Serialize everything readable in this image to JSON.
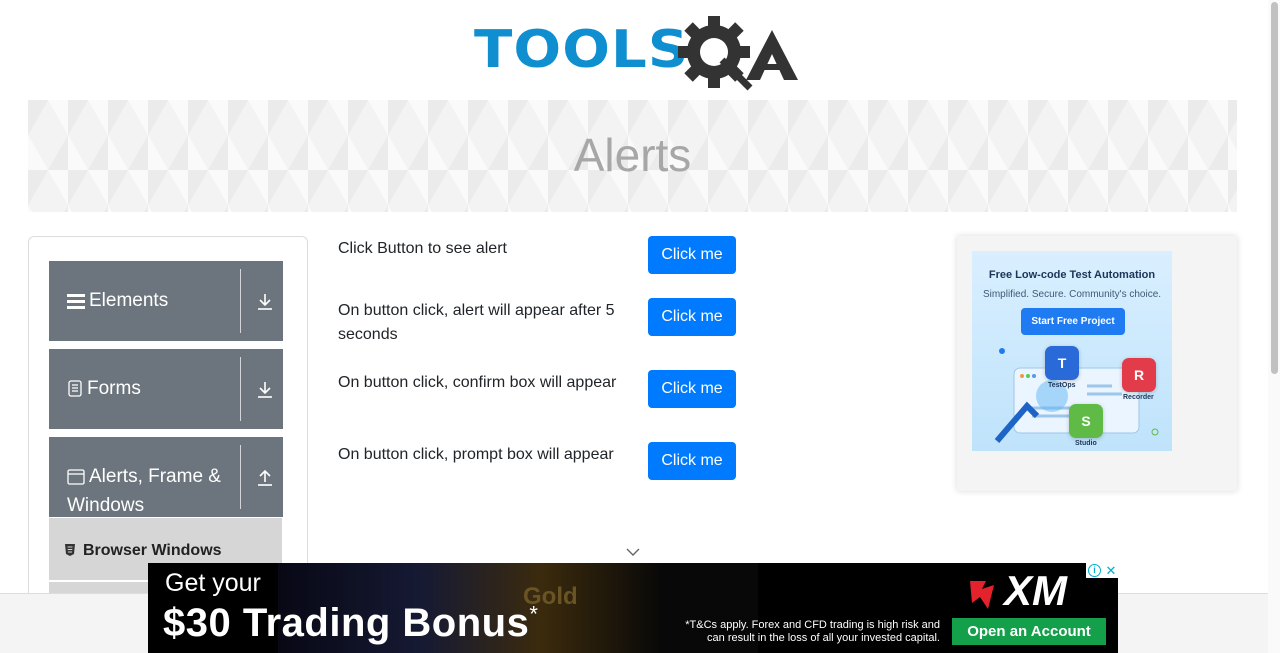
{
  "header": {
    "logo_text": "TOOLS",
    "logo_suffix": "QA"
  },
  "banner": {
    "title": "Alerts"
  },
  "sidebar": {
    "groups": [
      {
        "label": "Elements",
        "icon": "menu-icon",
        "arrow": "download-icon"
      },
      {
        "label": "Forms",
        "icon": "document-icon",
        "arrow": "download-icon"
      },
      {
        "label": "Alerts, Frame & Windows",
        "label_line1": "Alerts, Frame &",
        "label_line2": "Windows",
        "icon": "window-icon",
        "arrow": "upload-icon"
      }
    ],
    "sub_items": [
      {
        "label": "Browser Windows",
        "icon": "html5-icon"
      }
    ]
  },
  "alerts": {
    "rows": [
      {
        "text": "Click Button to see alert",
        "button": "Click me"
      },
      {
        "text": "On button click, alert will appear after 5 seconds",
        "button": "Click me"
      },
      {
        "text": "On button click, confirm box will appear",
        "button": "Click me"
      },
      {
        "text": "On button click, prompt box will appear",
        "button": "Click me"
      }
    ]
  },
  "side_ad": {
    "title": "Free Low-code Test Automation",
    "subtitle": "Simplified. Secure. Community's choice.",
    "cta": "Start Free Project",
    "products": [
      {
        "label": "TestOps",
        "abbr": "T",
        "color": "#2a6ad8"
      },
      {
        "label": "Recorder",
        "abbr": "R",
        "color": "#e23b4a"
      },
      {
        "label": "Studio",
        "abbr": "S",
        "color": "#5fbb46"
      }
    ]
  },
  "bottom_ad": {
    "line1": "Get your",
    "line2": "$30 Trading Bonus",
    "asterisk": "*",
    "background_text": "Gold",
    "disclaimer": "*T&Cs apply. Forex and CFD trading is high risk and can result in the loss of all your invested capital.",
    "brand": "XM",
    "cta": "Open an Account"
  },
  "colors": {
    "primary_button": "#007bff",
    "sidebar_group": "#6c757d",
    "logo_blue": "#0f8fcf",
    "ad_green": "#14a04a"
  }
}
